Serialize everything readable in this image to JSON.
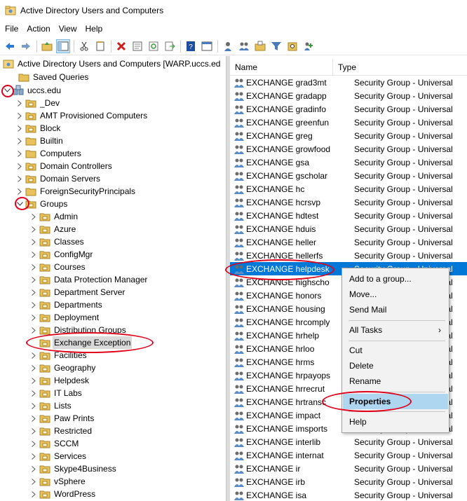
{
  "window": {
    "title": "Active Directory Users and Computers",
    "icon": "aduc-icon"
  },
  "menubar": [
    "File",
    "Action",
    "View",
    "Help"
  ],
  "toolbar": {
    "buttons": [
      "back-icon",
      "forward-icon",
      "up-folder-icon",
      "show-console-tree-icon",
      "cut-icon",
      "copy-icon",
      "delete-icon",
      "properties-icon",
      "refresh-icon",
      "export-icon",
      "help-icon",
      "console-icon",
      "new-user-icon",
      "new-group-icon",
      "new-ou-icon",
      "filter-icon",
      "find-icon",
      "add-to-group-icon"
    ]
  },
  "tree": {
    "root": "Active Directory Users and Computers [WARP.uccs.ed",
    "saved_queries": "Saved Queries",
    "domain": "uccs.edu",
    "domain_children": [
      "_Dev",
      "AMT Provisioned Computers",
      "Block",
      "Builtin",
      "Computers",
      "Domain Controllers",
      "Domain Servers",
      "ForeignSecurityPrincipals"
    ],
    "groups": "Groups",
    "group_children": [
      "Admin",
      "Azure",
      "Classes",
      "ConfigMgr",
      "Courses",
      "Data Protection Manager",
      "Department Server",
      "Departments",
      "Deployment",
      "Distribution Groups",
      "Exchange Exception",
      "Facilities",
      "Geography",
      "Helpdesk",
      "IT Labs",
      "Lists",
      "Paw Prints",
      "Restricted",
      "SCCM",
      "Services",
      "Skype4Business",
      "vSphere",
      "WordPress"
    ]
  },
  "list": {
    "col_name": "Name",
    "col_type": "Type",
    "type_value": "Security Group - Universal",
    "rows": [
      "EXCHANGE grad3mt",
      "EXCHANGE gradapp",
      "EXCHANGE gradinfo",
      "EXCHANGE greenfun",
      "EXCHANGE greg",
      "EXCHANGE growfood",
      "EXCHANGE gsa",
      "EXCHANGE gscholar",
      "EXCHANGE hc",
      "EXCHANGE hcrsvp",
      "EXCHANGE hdtest",
      "EXCHANGE hduis",
      "EXCHANGE heller",
      "EXCHANGE hellerfs",
      "EXCHANGE helpdesk",
      "EXCHANGE highscho",
      "EXCHANGE honors",
      "EXCHANGE housing",
      "EXCHANGE hrcomply",
      "EXCHANGE hrhelp",
      "EXCHANGE hrloo",
      "EXCHANGE hrms",
      "EXCHANGE hrpayops",
      "EXCHANGE hrrecrut",
      "EXCHANGE hrtransc",
      "EXCHANGE impact",
      "EXCHANGE imsports",
      "EXCHANGE interlib",
      "EXCHANGE internat",
      "EXCHANGE ir",
      "EXCHANGE irb",
      "EXCHANGE isa"
    ],
    "selected": "EXCHANGE helpdesk"
  },
  "context_menu": {
    "items": [
      "Add to a group...",
      "Move...",
      "Send Mail",
      "All Tasks",
      "Cut",
      "Delete",
      "Rename",
      "Properties",
      "Help"
    ],
    "highlighted": "Properties",
    "submenu_arrow": "›"
  },
  "colors": {
    "selection": "#0078d7",
    "highlight": "#aed6f1",
    "annotation": "#e0001b",
    "folder": "#e8c25a"
  }
}
